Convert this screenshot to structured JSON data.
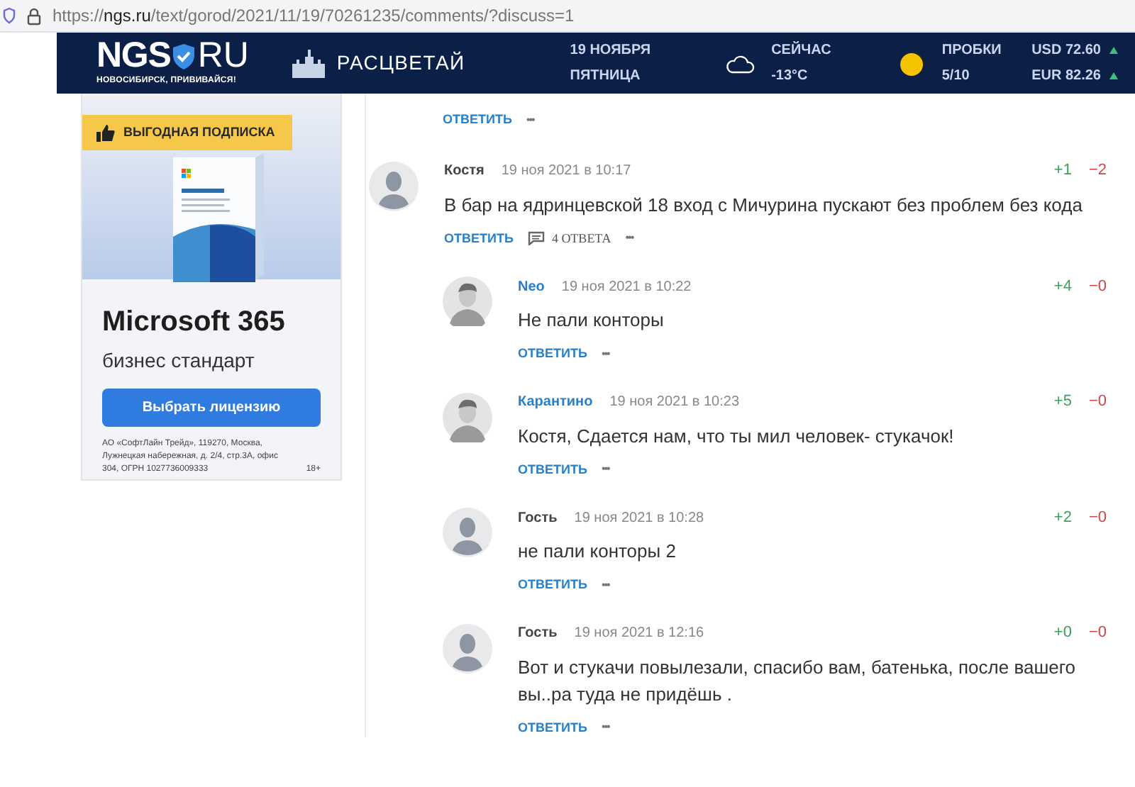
{
  "browser": {
    "url": "https://**ngs.ru**/text/gorod/2021/11/19/70261235/comments/?discuss=1"
  },
  "header": {
    "logo_left": "NGS",
    "logo_right": "RU",
    "tagline": "НОВОСИБИРСК, ПРИВИВАЙСЯ!",
    "partner": "РАСЦВЕТАЙ",
    "date": "19 НОЯБРЯ",
    "weekday": "ПЯТНИЦА",
    "weather_label": "СЕЙЧАС",
    "temperature": "-13°C",
    "traffic_label": "ПРОБКИ",
    "traffic_score": "5/10",
    "rates": [
      {
        "text": "USD 72.60",
        "rising": true
      },
      {
        "text": "EUR 82.26",
        "rising": true
      }
    ]
  },
  "ad": {
    "badge": "ВЫГОДНАЯ ПОДПИСКА",
    "title": "Microsoft 365",
    "subtitle": "бизнес стандарт",
    "button": "Выбрать лицензию",
    "legal": "АО «СофтЛайн Трейд», 119270, Москва, Лужнецкая набережная, д. 2/4, стр.3А, офис 304, ОГРН 1027736009333",
    "age": "18+"
  },
  "partial_comment": {
    "reply": "ОТВЕТИТЬ",
    "more": "•••"
  },
  "comments": [
    {
      "author": "Костя",
      "registered": false,
      "avatar": {
        "kind": "default"
      },
      "date": "19 ноя 2021 в 10:17",
      "plus": "+1",
      "minus": "−2",
      "text": "В бар на ядринцевской 18 вход с Мичурина пускают без проблем без кода",
      "reply": "ОТВЕТИТЬ",
      "replies_count": "4 ОТВЕТА",
      "more": "•••",
      "children": [
        {
          "author": "Neo",
          "registered": true,
          "date": "19 ноя 2021 в 10:22",
          "plus": "+4",
          "minus": "−0",
          "text": "Не пали конторы",
          "reply": "ОТВЕТИТЬ",
          "more": "•••"
        },
        {
          "author": "Карантино",
          "registered": true,
          "date": "19 ноя 2021 в 10:23",
          "plus": "+5",
          "minus": "−0",
          "text": "Костя, Сдается нам, что ты мил человек- стукачок!",
          "reply": "ОТВЕТИТЬ",
          "more": "•••"
        },
        {
          "author": "Гость",
          "registered": false,
          "avatar": {
            "kind": "default"
          },
          "date": "19 ноя 2021 в 10:28",
          "plus": "+2",
          "minus": "−0",
          "text": "не пали конторы 2",
          "reply": "ОТВЕТИТЬ",
          "more": "•••"
        },
        {
          "author": "Гость",
          "registered": false,
          "avatar": {
            "kind": "default"
          },
          "date": "19 ноя 2021 в 12:16",
          "plus": "+0",
          "minus": "−0",
          "text": "Вот и стукачи повылезали, спасибо вам, батенька, после вашего вы..ра туда не придёшь .",
          "reply": "ОТВЕТИТЬ",
          "more": "•••"
        }
      ]
    }
  ]
}
